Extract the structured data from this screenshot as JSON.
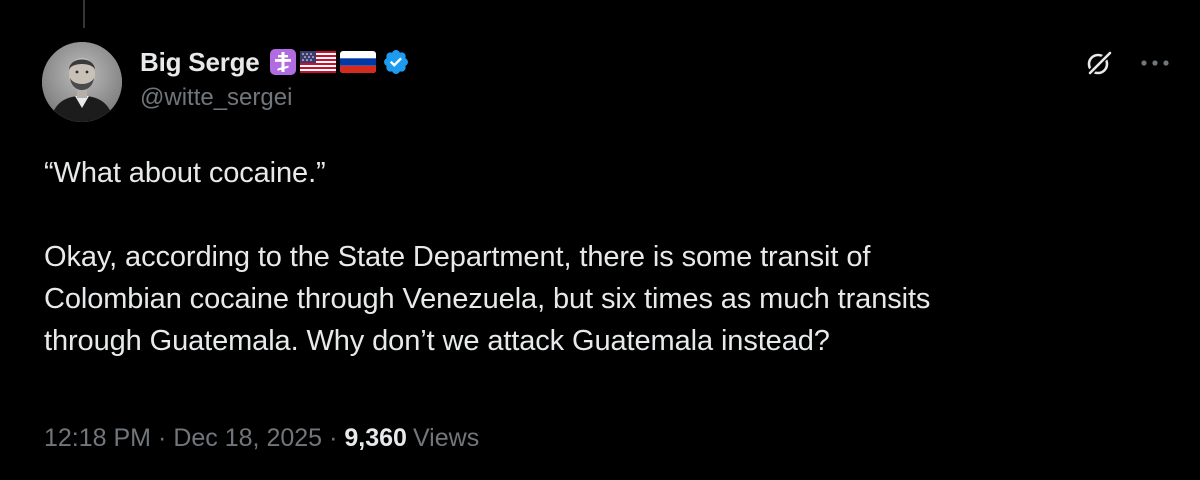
{
  "author": {
    "display_name": "Big Serge",
    "handle": "@witte_sergei",
    "badges": [
      "orthodox-cross-icon",
      "us-flag-icon",
      "russia-flag-icon",
      "verified-badge-icon"
    ],
    "avatar_icon": "avatar"
  },
  "actions": {
    "grok_icon": "grok-icon",
    "more_icon": "more-icon"
  },
  "tweet": {
    "paragraph_1": "“What about cocaine.”",
    "paragraph_2_line_1": "Okay, according to the State Department, there is some transit of",
    "paragraph_2_line_2": "Colombian cocaine through Venezuela, but six times as much transits",
    "paragraph_2_line_3": "through Guatemala. Why don’t we attack Guatemala instead?"
  },
  "meta": {
    "time": "12:18 PM",
    "separator": "·",
    "date": "Dec 18, 2025",
    "views_count": "9,360",
    "views_label": "Views"
  },
  "colors": {
    "background": "#000000",
    "text_primary": "#e7e9ea",
    "text_secondary": "#71767b",
    "verified_blue": "#1d9bf0",
    "cross_purple": "#b06ce0"
  }
}
